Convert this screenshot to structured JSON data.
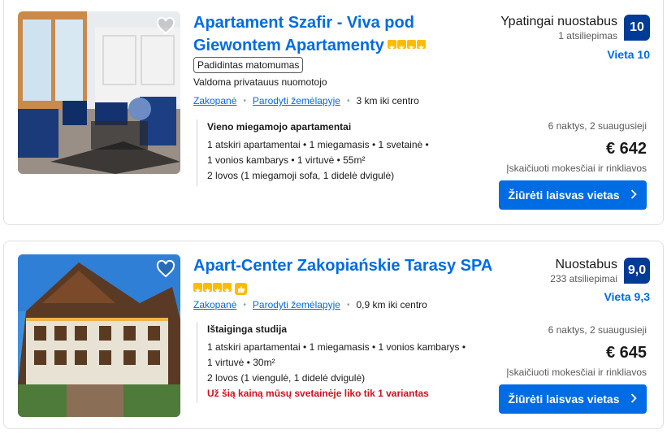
{
  "listings": [
    {
      "title": "Apartament Szafir - Viva pod Giewontem Apartamenty",
      "stars": 4,
      "badge": "Padidintas matomumas",
      "managed": "Valdoma privatauus nuomotojo",
      "city": "Zakopanė",
      "map_link": "Parodyti žemėlapyje",
      "distance": "3 km iki centro",
      "unit_name": "Vieno miegamojo apartamentai",
      "unit_lines": [
        "1 atskiri apartamentai • 1 miegamasis • 1 svetainė •",
        "1 vonios kambarys • 1 virtuvė • 55m²",
        "2 lovos (1 miegamoji sofa, 1 didelė dvigulė)"
      ],
      "review_word": "Ypatingai nuostabus",
      "review_count": "1 atsiliepimas",
      "score": "10",
      "location_score": "Vieta 10",
      "nights": "6 naktys, 2 suaugusieji",
      "price": "€ 642",
      "taxes": "Įskaičiuoti mokesčiai ir rinkliavos",
      "cta": "Žiūrėti laisvas vietas"
    },
    {
      "title": "Apart-Center Zakopiańskie Tarasy SPA",
      "stars": 4,
      "city": "Zakopanė",
      "map_link": "Parodyti žemėlapyje",
      "distance": "0,9 km iki centro",
      "unit_name": "Ištaiginga studija",
      "unit_lines": [
        "1 atskiri apartamentai • 1 miegamasis • 1 vonios kambarys •",
        "1 virtuvė • 30m²",
        "2 lovos (1 viengulė, 1 didelė dvigulė)"
      ],
      "scarcity": "Už šią kainą mūsų svetainėje liko tik 1 variantas",
      "review_word": "Nuostabus",
      "review_count": "233 atsiliepimai",
      "score": "9,0",
      "location_score": "Vieta 9,3",
      "nights": "6 naktys, 2 suaugusieji",
      "price": "€ 645",
      "taxes": "Įskaičiuoti mokesčiai ir rinkliavos",
      "cta": "Žiūrėti laisvas vietas"
    }
  ],
  "icons": {
    "favorite": "heart-icon",
    "arrow": "chevron-right-icon",
    "thumbs_up": "thumbs-up-icon"
  },
  "colors": {
    "link": "#006ce4",
    "score_bg": "#003b95",
    "star": "#febb02",
    "scarcity": "#d4111e"
  }
}
